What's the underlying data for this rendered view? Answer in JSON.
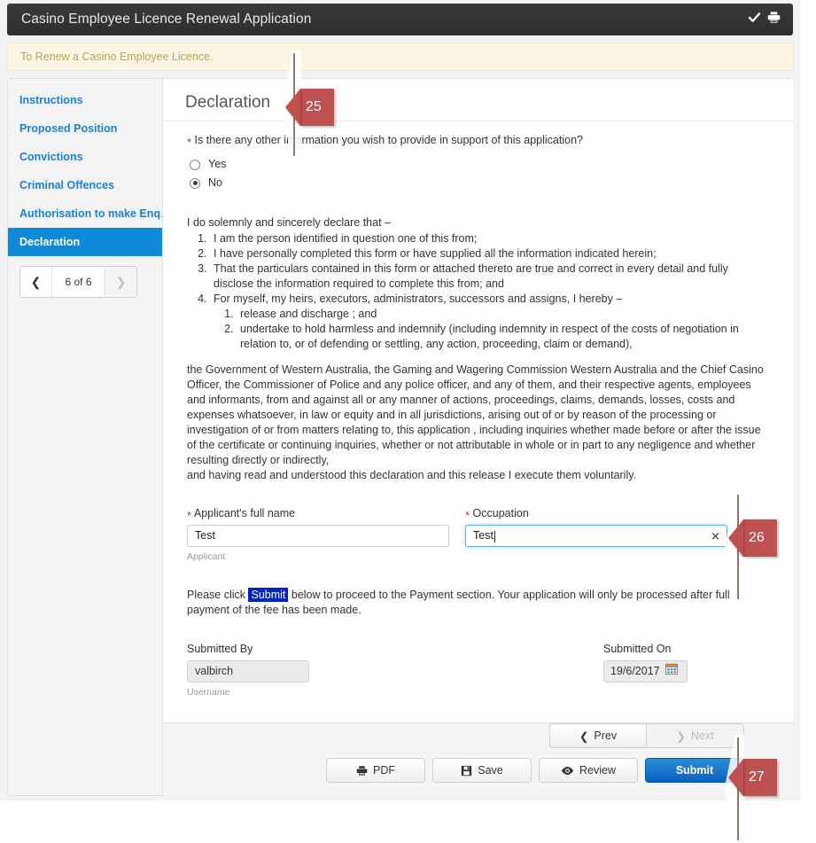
{
  "titlebar": {
    "title": "Casino Employee Licence Renewal Application",
    "icons": [
      "check-icon",
      "printer-icon"
    ]
  },
  "banner": {
    "text": "To Renew a Casino Employee Licence."
  },
  "sidebar": {
    "items": [
      {
        "label": "Instructions",
        "active": false
      },
      {
        "label": "Proposed Position",
        "active": false
      },
      {
        "label": "Convictions",
        "active": false
      },
      {
        "label": "Criminal Offences",
        "active": false
      },
      {
        "label": "Authorisation to make Enq…",
        "active": false
      },
      {
        "label": "Declaration",
        "active": true
      }
    ],
    "pager": {
      "prev_icon": "chevron-left-icon",
      "next_icon": "chevron-right-icon",
      "label": "6 of 6",
      "next_disabled": true
    }
  },
  "content": {
    "title": "Declaration",
    "question": "Is there any other information you wish to provide in support of this application?",
    "question_required": true,
    "options": [
      {
        "label": "Yes",
        "selected": false
      },
      {
        "label": "No",
        "selected": true
      }
    ],
    "declare_intro": "I do solemnly and sincerely declare that –",
    "declare_items": [
      "I am the person identified in question one of this from;",
      "I have personally completed this form or have supplied all the information indicated herein;",
      "That the particulars contained in this form or attached thereto are true and correct in every detail and fully disclose the information required to complete this from; and",
      "For myself, my heirs, executors, administrators, successors and assigns, I hereby –"
    ],
    "declare_subitems": [
      "release and discharge ; and",
      "undertake to hold harmless and indemnify (including indemnity in respect of the costs of negotiation in relation to, or of defending or settling, any action, proceeding, claim or demand),"
    ],
    "release_paragraph": "the Government of Western Australia, the Gaming and Wagering Commission Western Australia and the Chief Casino Officer, the Commissioner of Police and any police officer, and any of them, and their respective agents, employees and informants, from and against all or any manner of actions, proceedings, claims, demands, losses, costs and expenses whatsoever, in law or equity and in all jurisdictions, arising out of or by reason of the processing or investigation of or from matters relating to, this application , including inquiries whether made before or after the issue of the certificate or continuing inquiries, whether or not attributable in whole or in part to any negligence and whether resulting directly or indirectly,",
    "voluntary_paragraph": "and having read and understood this declaration and this release I execute them voluntarily.",
    "applicant_name": {
      "label": "Applicant's full name",
      "required": true,
      "value": "Test",
      "help": "Applicant"
    },
    "occupation": {
      "label": "Occupation",
      "required": true,
      "value": "Test",
      "focused": true,
      "clear_icon": "clear-x-icon"
    },
    "instruction": {
      "before": "Please click ",
      "highlight": "Submit",
      "after": " below to proceed to the Payment section. Your application will only be processed after full payment of the fee has been made."
    },
    "submitted_by": {
      "label": "Submitted By",
      "value": "valbirch",
      "help": "Username"
    },
    "submitted_on": {
      "label": "Submitted On",
      "value": "19/6/2017",
      "icon": "calendar-icon"
    }
  },
  "footer": {
    "prev": {
      "label": "Prev",
      "icon": "chevron-left-icon",
      "disabled": false
    },
    "next": {
      "label": "Next",
      "icon": "chevron-right-icon",
      "disabled": true
    },
    "actions": [
      {
        "label": "PDF",
        "icon": "printer-icon",
        "primary": false
      },
      {
        "label": "Save",
        "icon": "floppy-disk-icon",
        "primary": false
      },
      {
        "label": "Review",
        "icon": "eye-icon",
        "primary": false
      },
      {
        "label": "Submit",
        "icon": "",
        "primary": true
      }
    ]
  },
  "callouts": [
    {
      "number": "25"
    },
    {
      "number": "26"
    },
    {
      "number": "27"
    }
  ],
  "colors": {
    "accent": "#0d8bd9",
    "link": "#1b7fd4",
    "banner_text": "#bf9f56",
    "callout": "#bf5050",
    "highlight": "#0024c8",
    "submit": "#0b5fc0"
  }
}
